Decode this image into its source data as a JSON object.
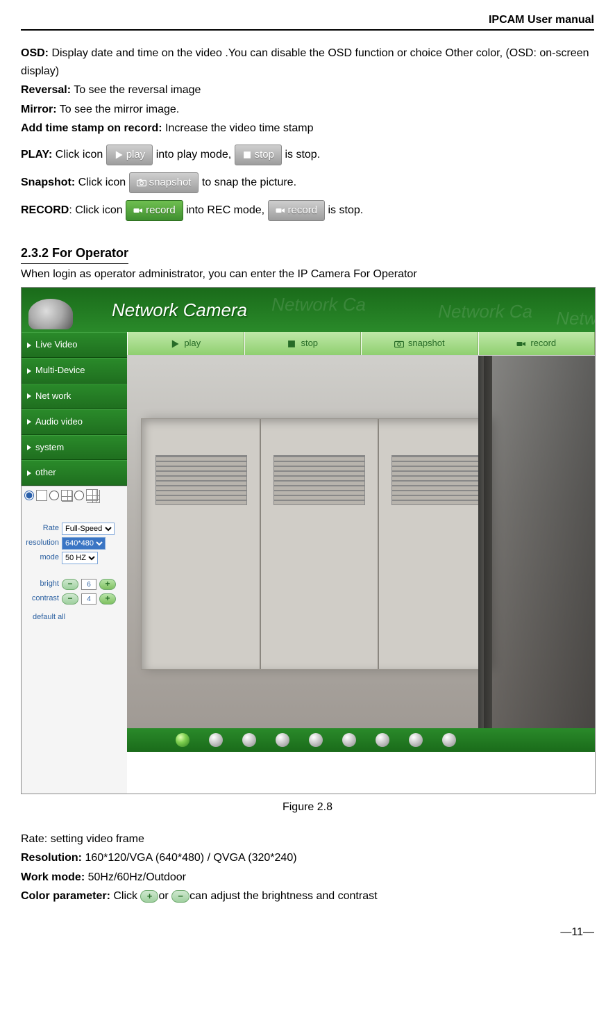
{
  "header": "IPCAM User manual",
  "osd_label": "OSD:",
  "osd_text": " Display date and time on the video .You can disable the OSD function or choice Other color, (OSD: on-screen display)",
  "reversal_label": "Reversal:",
  "reversal_text": " To see the reversal image",
  "mirror_label": "Mirror:",
  "mirror_text": " To see the mirror image.",
  "timestamp_label": "Add time stamp on record:",
  "timestamp_text": " Increase the video time stamp",
  "play_label": "PLAY:",
  "play_pre": " Click icon ",
  "play_btn": "play",
  "play_mid": " into play mode, ",
  "stop_btn": "stop",
  "play_post": " is stop.",
  "snapshot_label": "Snapshot:",
  "snapshot_pre": " Click icon ",
  "snapshot_btn": "snapshot",
  "snapshot_post": " to snap the picture.",
  "record_label": "RECORD",
  "record_pre": ": Click icon ",
  "record_btn1": "record",
  "record_mid": " into REC mode, ",
  "record_btn2": "record",
  "record_post": " is stop.",
  "section_heading": "2.3.2   For Operator",
  "section_text": "When login as operator administrator, you can enter the IP Camera For Operator",
  "figure_caption": "Figure 2.8",
  "rate_line": "Rate: setting video frame",
  "resolution_label": "Resolution:",
  "resolution_text": " 160*120/VGA (640*480) / QVGA (320*240)",
  "workmode_label": "Work mode:",
  "workmode_text": " 50Hz/60Hz/Outdoor",
  "colorparam_label": "Color parameter:",
  "colorparam_pre": " Click ",
  "plus_sym": "+",
  "colorparam_mid": "or ",
  "minus_sym": "−",
  "colorparam_post": "can adjust the brightness and contrast",
  "page_num": "—11—",
  "screenshot": {
    "banner_title": "Network Camera",
    "ghost": "Network Ca",
    "nav": [
      "Live Video",
      "Multi-Device",
      "Net work",
      "Audio video",
      "system",
      "other"
    ],
    "toolbar": [
      "play",
      "stop",
      "snapshot",
      "record"
    ],
    "rate_label": "Rate",
    "rate_value": "Full-Speed",
    "resolution_label": "resolution",
    "resolution_value": "640*480",
    "mode_label": "mode",
    "mode_value": "50 HZ",
    "bright_label": "bright",
    "bright_value": "6",
    "contrast_label": "contrast",
    "contrast_value": "4",
    "default_all": "default all"
  }
}
